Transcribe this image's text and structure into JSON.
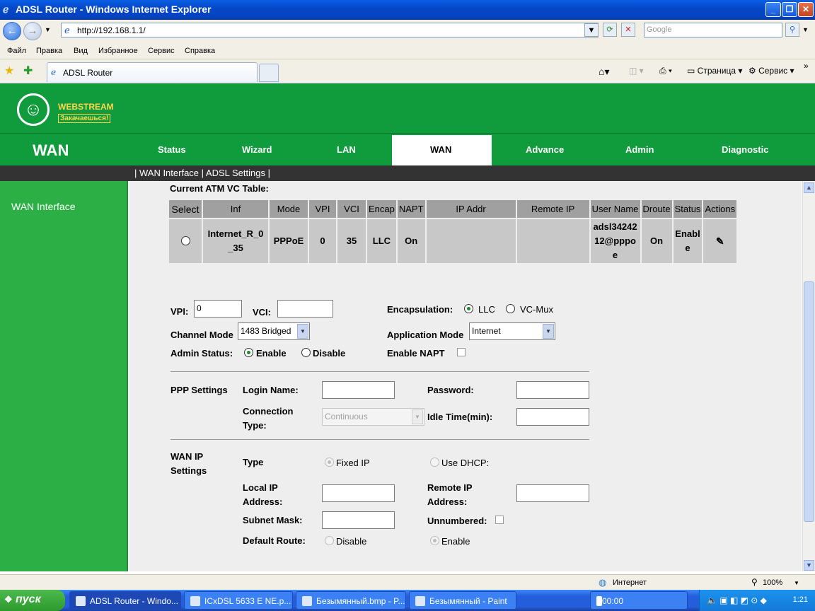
{
  "window": {
    "title": "ADSL Router - Windows Internet Explorer"
  },
  "browser": {
    "address": "http://192.168.1.1/",
    "search_placeholder": "Google",
    "menu": [
      "Файл",
      "Правка",
      "Вид",
      "Избранное",
      "Сервис",
      "Справка"
    ],
    "tab_title": "ADSL Router",
    "commands": {
      "page": "Страница",
      "tools": "Сервис"
    }
  },
  "brand": {
    "line1": "WEBSTREAM",
    "line2": "Закачаешься!"
  },
  "nav": {
    "section": "WAN",
    "items": [
      "Status",
      "Wizard",
      "LAN",
      "WAN",
      "Advance",
      "Admin",
      "Diagnostic"
    ],
    "active": "WAN"
  },
  "subnav": "| WAN Interface | ADSL Settings |",
  "sidebar": {
    "item": "WAN Interface"
  },
  "atm_table": {
    "title": "Current ATM VC Table:",
    "headers": [
      "Select",
      "Inf",
      "Mode",
      "VPI",
      "VCI",
      "Encap",
      "NAPT",
      "IP Addr",
      "Remote IP",
      "User Name",
      "Droute",
      "Status",
      "Actions"
    ],
    "row": {
      "inf": "Internet_R_0_35",
      "mode": "PPPoE",
      "vpi": "0",
      "vci": "35",
      "encap": "LLC",
      "napt": "On",
      "ip_addr": "",
      "remote_ip": "",
      "user_name": "adsl3424212@pppoe",
      "droute": "On",
      "status": "Enable"
    }
  },
  "form": {
    "vpi_label": "VPI:",
    "vpi_value": "0",
    "vci_label": "VCI:",
    "vci_value": "",
    "encap_label": "Encapsulation:",
    "encap_llc": "LLC",
    "encap_vcmux": "VC-Mux",
    "encap_selected": "LLC",
    "channel_mode_label": "Channel Mode",
    "channel_mode_value": "1483 Bridged",
    "app_mode_label": "Application Mode",
    "app_mode_value": "Internet",
    "admin_status_label": "Admin Status:",
    "admin_enable": "Enable",
    "admin_disable": "Disable",
    "admin_selected": "Enable",
    "enable_napt_label": "Enable NAPT",
    "enable_napt_checked": false
  },
  "ppp": {
    "section": "PPP Settings",
    "login_label": "Login Name:",
    "password_label": "Password:",
    "conn_type_label": "Connection Type:",
    "conn_type_value": "Continuous",
    "idle_label": "Idle Time(min):"
  },
  "wanip": {
    "section": "WAN IP Settings",
    "type_label": "Type",
    "fixed_ip": "Fixed IP",
    "use_dhcp": "Use DHCP:",
    "local_ip_label": "Local IP Address:",
    "remote_ip_label": "Remote IP Address:",
    "subnet_label": "Subnet Mask:",
    "unnumbered_label": "Unnumbered:",
    "default_route_label": "Default Route:",
    "dr_disable": "Disable",
    "dr_enable": "Enable"
  },
  "statusbar": {
    "zone": "Интернет",
    "zoom": "100%"
  },
  "taskbar": {
    "start": "пуск",
    "tasks": [
      "ADSL Router - Windo...",
      "ICxDSL 5633 E NE.p...",
      "Безымянный.bmp - P...",
      "Безымянный - Paint"
    ],
    "clock_task": "00:00",
    "time": "1:21"
  }
}
